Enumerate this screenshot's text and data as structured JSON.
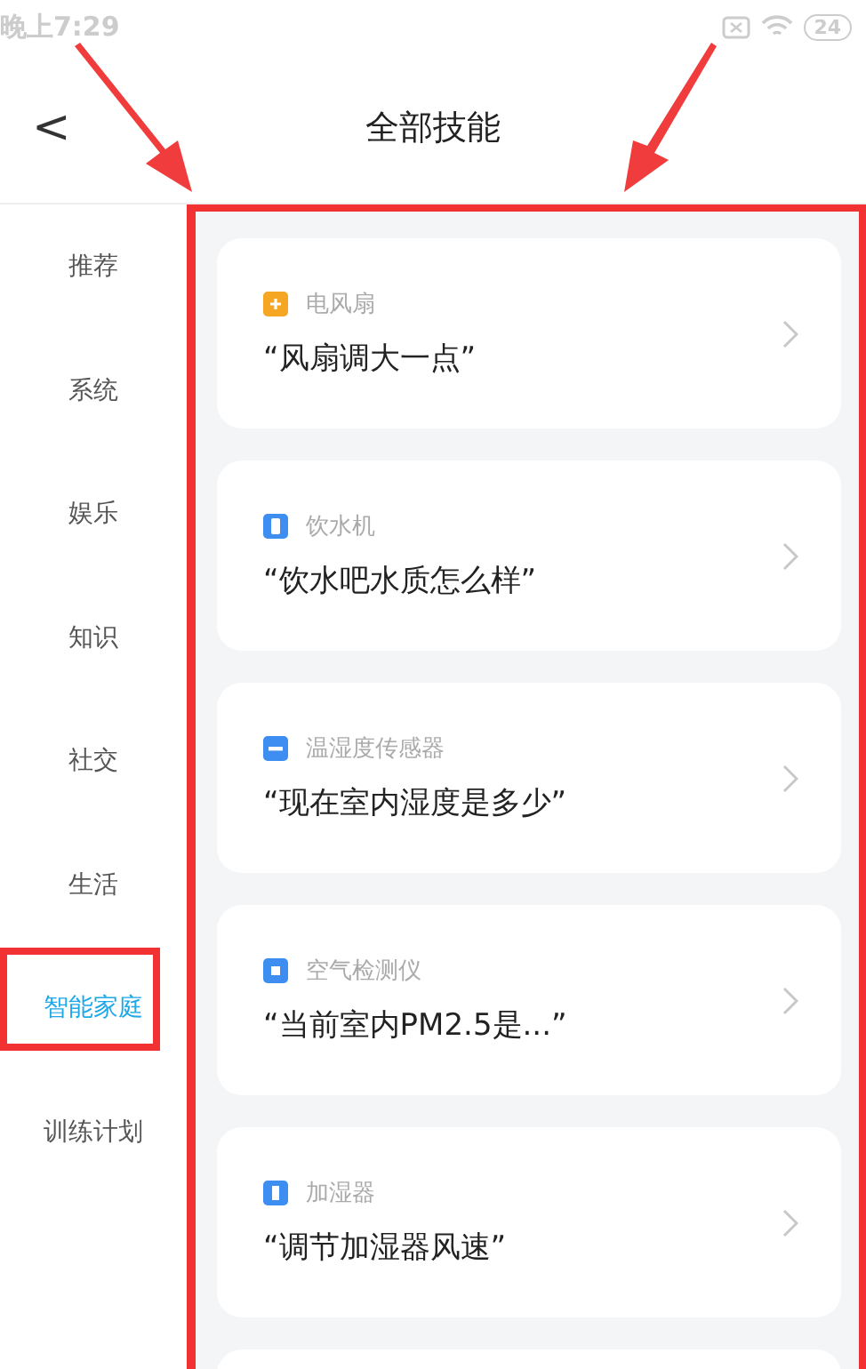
{
  "status_bar": {
    "time": "晚上7:29",
    "battery": "24"
  },
  "header": {
    "back": "<",
    "title": "全部技能"
  },
  "sidebar": {
    "items": [
      {
        "label": "推荐",
        "selected": false
      },
      {
        "label": "系统",
        "selected": false
      },
      {
        "label": "娱乐",
        "selected": false
      },
      {
        "label": "知识",
        "selected": false
      },
      {
        "label": "社交",
        "selected": false
      },
      {
        "label": "生活",
        "selected": false
      },
      {
        "label": "智能家庭",
        "selected": true
      },
      {
        "label": "训练计划",
        "selected": false
      }
    ]
  },
  "skills": [
    {
      "device": "电风扇",
      "phrase": "“风扇调大一点”",
      "kind": "plus",
      "color": "#f5a623"
    },
    {
      "device": "饮水机",
      "phrase": "“饮水吧水质怎么样”",
      "kind": "tall",
      "color": "#3d8ef0"
    },
    {
      "device": "温湿度传感器",
      "phrase": "“现在室内湿度是多少”",
      "kind": "dash",
      "color": "#3d8ef0"
    },
    {
      "device": "空气检测仪",
      "phrase": "“当前室内PM2.5是...”",
      "kind": "square",
      "color": "#3d8ef0"
    },
    {
      "device": "加湿器",
      "phrase": "“调节加湿器风速”",
      "kind": "bar",
      "color": "#3d8ef0"
    }
  ]
}
